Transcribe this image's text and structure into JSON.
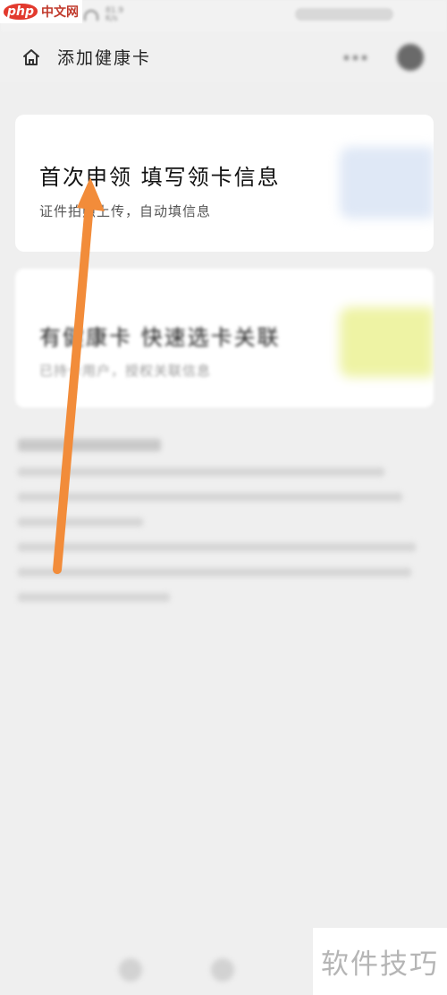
{
  "watermark": {
    "logo": "php",
    "site": "中文网",
    "bottom": "软件技巧"
  },
  "status_bar": {
    "net_speed": "81.9 K/s"
  },
  "header": {
    "title": "添加健康卡"
  },
  "cards": [
    {
      "title": "首次申领 填写领卡信息",
      "description": "证件拍照上传，自动填信息"
    },
    {
      "title": "有健康卡 快速选卡关联",
      "description": "已持卡用户，授权关联信息"
    }
  ],
  "colors": {
    "background": "#efefef",
    "card": "#ffffff",
    "arrow": "#f28c3a",
    "card1_art": "#dfe8f6",
    "card2_art": "#eef3a4"
  },
  "icons": {
    "home": "home-icon",
    "more": "more-dots-icon",
    "close": "close-circle-icon",
    "annotation": "orange-arrow-icon"
  }
}
